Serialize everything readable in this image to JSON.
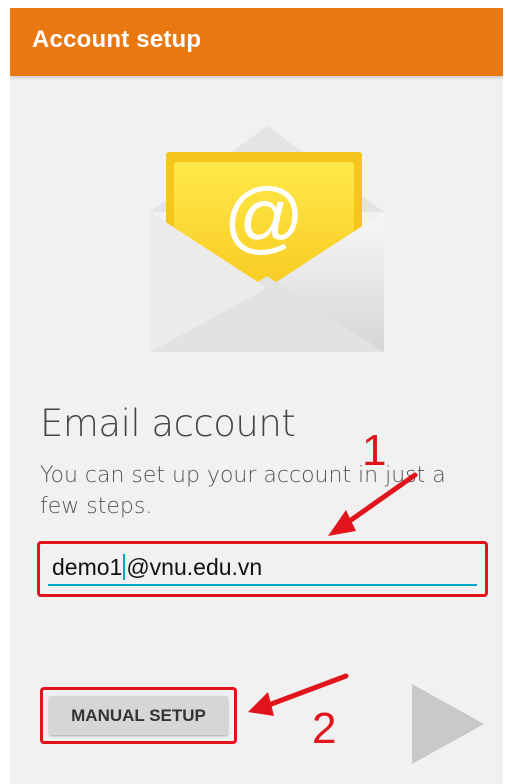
{
  "appbar": {
    "title": "Account setup"
  },
  "content": {
    "heading": "Email account",
    "subtext": "You can set up your account in just a few steps.",
    "email_value_part1": "demo1",
    "email_value_part2": "@vnu.edu.vn",
    "manual_setup_label": "MANUAL SETUP"
  },
  "annotations": {
    "step1": "1",
    "step2": "2",
    "color": "#e1141b"
  },
  "colors": {
    "appbar": "#e8780f",
    "accent": "#00a8c8",
    "background": "#f1f1f1"
  },
  "icons": {
    "envelope": "email-envelope-icon",
    "next": "next-arrow-icon"
  }
}
